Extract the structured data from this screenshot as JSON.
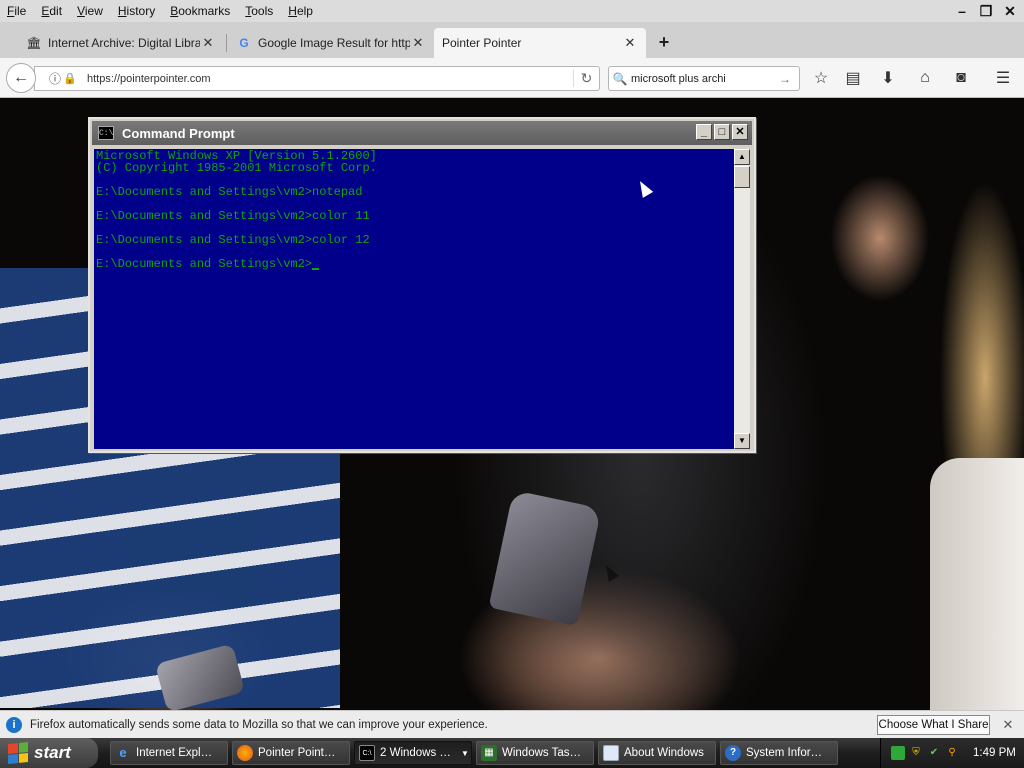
{
  "menubar": {
    "items": [
      "File",
      "Edit",
      "View",
      "History",
      "Bookmarks",
      "Tools",
      "Help"
    ]
  },
  "window_controls": {
    "minimize": "–",
    "restore": "❐",
    "close": "✕"
  },
  "tabs": [
    {
      "label": "Internet Archive: Digital Libra…",
      "icon": "archive-icon"
    },
    {
      "label": "Google Image Result for http…",
      "icon": "google-icon"
    },
    {
      "label": "Pointer Pointer",
      "icon": ""
    }
  ],
  "new_tab": "+",
  "nav": {
    "url": "https://pointerpointer.com",
    "search_value": "microsoft plus archi"
  },
  "cmd": {
    "title": "Command Prompt",
    "lines": [
      "Microsoft Windows XP [Version 5.1.2600]",
      "(C) Copyright 1985-2001 Microsoft Corp.",
      "",
      "E:\\Documents and Settings\\vm2>notepad",
      "",
      "E:\\Documents and Settings\\vm2>color 11",
      "",
      "E:\\Documents and Settings\\vm2>color 12",
      "",
      "E:\\Documents and Settings\\vm2>"
    ],
    "colors": {
      "background": "#00008b",
      "text": "#13a10e"
    }
  },
  "notification": {
    "text": "Firefox automatically sends some data to Mozilla so that we can improve your experience.",
    "button": "Choose What I Share"
  },
  "taskbar": {
    "start_label": "start",
    "tasks": [
      {
        "label": "Internet Expl…",
        "icon": "ie-icon"
      },
      {
        "label": "Pointer Point…",
        "icon": "firefox-icon"
      },
      {
        "label": "2 Windows …",
        "icon": "cmd-icon"
      },
      {
        "label": "Windows Tas…",
        "icon": "task-manager-icon"
      },
      {
        "label": "About Windows",
        "icon": "window-icon"
      },
      {
        "label": "System Infor…",
        "icon": "help-icon"
      }
    ],
    "clock": "1:49 PM"
  }
}
